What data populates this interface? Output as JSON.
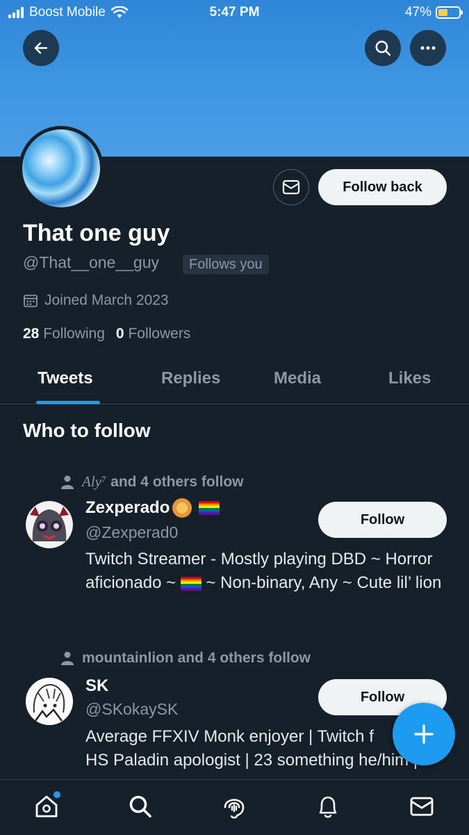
{
  "status_bar": {
    "carrier": "Boost Mobile",
    "time": "5:47 PM",
    "battery": "47%",
    "battery_level": 0.47
  },
  "profile": {
    "display_name": "That one guy",
    "handle": "@That__one__guy",
    "follows_you": "Follows you",
    "joined": "Joined March 2023",
    "following_count": "28",
    "following_label": "Following",
    "followers_count": "0",
    "followers_label": "Followers",
    "follow_back_label": "Follow back"
  },
  "tabs": [
    {
      "label": "Tweets",
      "active": true
    },
    {
      "label": "Replies",
      "active": false
    },
    {
      "label": "Media",
      "active": false
    },
    {
      "label": "Likes",
      "active": false
    }
  ],
  "who_to_follow": {
    "title": "Who to follow",
    "users": [
      {
        "social_name": "Aly⁷",
        "social_rest": "and 4 others follow",
        "name": "Zexperado",
        "handle": "@Zexperad0",
        "bio": "Twitch Streamer - Mostly playing DBD ~ Horror aficionado ~ 🏳️‍🌈 ~ Non-binary, Any ~ Cute lil’ lion",
        "bio_part1": "Twitch Streamer - Mostly playing DBD ~ Horror aficionado ~ ",
        "bio_part2": " ~ Non-binary, Any ~ Cute lil’ lion",
        "follow_label": "Follow"
      },
      {
        "social_name": "mountainlion",
        "social_rest": "and 4 others follow",
        "name": "SK",
        "handle": "@SKokaySK",
        "bio": "Average FFXIV Monk enjoyer | Twitch f... HS Paladin apologist | 23 something he/him |",
        "bio_line1": "Average FFXIV Monk enjoyer | Twitch f",
        "bio_line2": "HS Paladin apologist | 23 something he/him |",
        "follow_label": "Follow"
      }
    ]
  },
  "icons": {
    "back": "arrow-left-icon",
    "search": "search-icon",
    "more": "more-icon",
    "message": "envelope-icon",
    "calendar": "calendar-icon",
    "person": "person-icon",
    "compose": "plus-icon",
    "nav": [
      "home-icon",
      "search-icon",
      "spaces-icon",
      "bell-icon",
      "envelope-icon"
    ]
  },
  "colors": {
    "accent": "#1d9bf0",
    "background": "#15202b",
    "banner": "#4097e2",
    "muted": "#8b98a5"
  }
}
